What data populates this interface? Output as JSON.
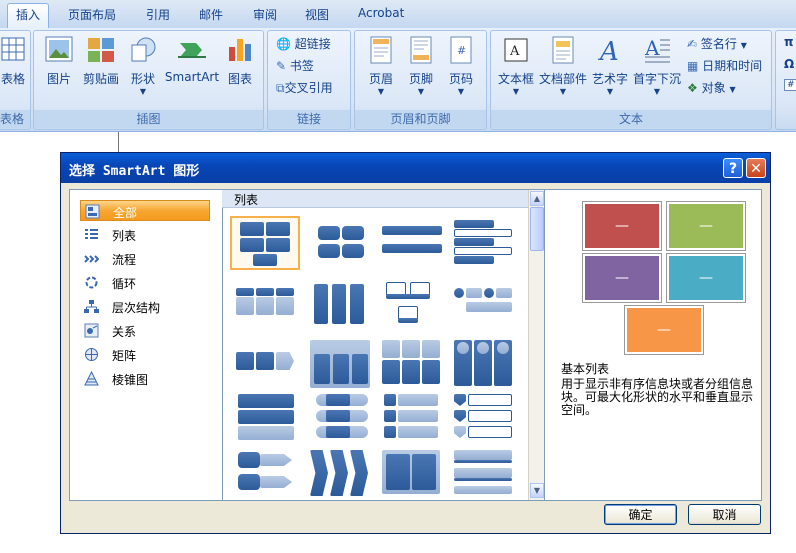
{
  "ribbon": {
    "tabs": [
      "插入",
      "页面布局",
      "引用",
      "邮件",
      "审阅",
      "视图",
      "Acrobat"
    ],
    "active_tab": "插入",
    "table_group": {
      "button": "表格",
      "label": "表格"
    },
    "illustrations": {
      "label": "插图",
      "buttons": [
        "图片",
        "剪贴画",
        "形状",
        "SmartArt",
        "图表"
      ]
    },
    "links": {
      "label": "链接",
      "items": [
        "超链接",
        "书签",
        "交叉引用"
      ]
    },
    "header_footer": {
      "label": "页眉和页脚",
      "buttons": [
        "页眉",
        "页脚",
        "页码"
      ]
    },
    "text": {
      "label": "文本",
      "buttons": [
        "文本框",
        "文档部件",
        "艺术字",
        "首字下沉"
      ],
      "items": [
        "签名行",
        "日期和时间",
        "对象"
      ]
    }
  },
  "dialog": {
    "title": "选择 SmartArt 图形",
    "categories": [
      {
        "label": "全部",
        "icon": "all-icon"
      },
      {
        "label": "列表",
        "icon": "list-icon"
      },
      {
        "label": "流程",
        "icon": "process-icon"
      },
      {
        "label": "循环",
        "icon": "cycle-icon"
      },
      {
        "label": "层次结构",
        "icon": "hierarchy-icon"
      },
      {
        "label": "关系",
        "icon": "relationship-icon"
      },
      {
        "label": "矩阵",
        "icon": "matrix-icon"
      },
      {
        "label": "棱锥图",
        "icon": "pyramid-icon"
      }
    ],
    "selected_category": "全部",
    "layout_header": "列表",
    "preview": {
      "name": "基本列表",
      "description": "用于显示非有序信息块或者分组信息块。可最大化形状的水平和垂直显示空间。",
      "box_label": "—",
      "colors": [
        "#c0504d",
        "#9bbb59",
        "#8064a2",
        "#4bacc6",
        "#f79646"
      ]
    },
    "ok": "确定",
    "cancel": "取消"
  },
  "colors": {
    "accent": "#f7a733",
    "title_bar": "#0a5fd8",
    "ribbon": "#d7e5f7"
  }
}
